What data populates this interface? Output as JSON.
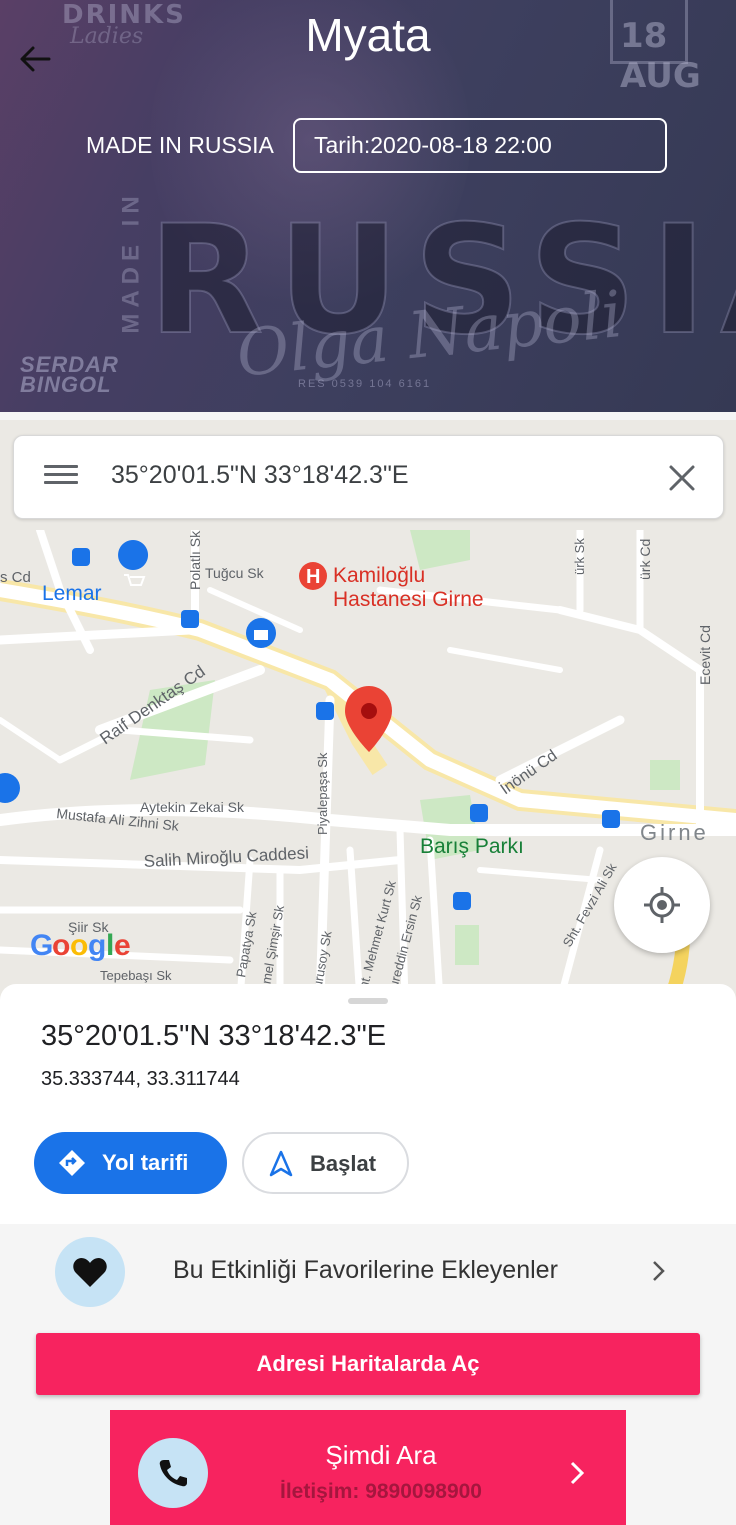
{
  "header": {
    "title": "Myata",
    "event_name": "MADE IN RUSSIA",
    "date_label": "Tarih:2020-08-18 22:00"
  },
  "poster": {
    "drinks": "DRINKS",
    "ladies": "Ladies",
    "date": "18 AUG",
    "made_in": "MADE IN",
    "russia": "RUSSIA",
    "olga": "Olga Napoli",
    "logo_line1": "SERDAR",
    "logo_line2": "BINGOL",
    "res": "RES 0539 104 6161"
  },
  "map": {
    "search_text": "35°20'01.5\"N 33°18'42.3\"E",
    "labels": {
      "lemar": "Lemar",
      "hospital_1": "Kamiloğlu",
      "hospital_2": "Hastanesi Girne",
      "tugcu": "Tuğcu Sk",
      "polatli": "Polatlı Sk",
      "raif": "Raif Denktaş Cd",
      "aytekin": "Aytekin Zekai Sk",
      "mustafa": "Mustafa Ali Zihni Sk",
      "salih": "Salih Miroğlu Caddesi",
      "piyalepasa": "Piyalepaşa Sk",
      "inonu": "İnönü Cd",
      "baris": "Barış Parkı",
      "girne": "Girne",
      "ecevit": "Ecevit Cd",
      "papatya": "Papatya Sk",
      "temel": "Temel Şimşir Sk",
      "durusoy": "Durusoy Sk",
      "mehmet": "Şht. Mehmet Kurt Sk",
      "nureddin": "Nureddin Ersin Sk",
      "fevzi": "Sht. Fevzi Ali Sk",
      "siir": "Şiir Sk",
      "tepebasi": "Tepebaşı Sk",
      "cd_left": "s Cd",
      "turk": "ürk Sk",
      "turk_cd": "ürk Cd"
    },
    "google": [
      "G",
      "o",
      "o",
      "g",
      "l",
      "e"
    ]
  },
  "sheet": {
    "coord_title": "35°20'01.5\"N 33°18'42.3\"E",
    "coord_decimal": "35.333744, 33.311744",
    "directions_label": "Yol tarifi",
    "start_label": "Başlat"
  },
  "favorites": {
    "label": "Bu Etkinliği Favorilerine Ekleyenler"
  },
  "actions": {
    "open_maps_label": "Adresi Haritalarda Aç",
    "call_title": "Şimdi Ara",
    "call_sub": "İletişim: 9890098900"
  },
  "colors": {
    "accent_pink": "#f7235f",
    "google_blue": "#1a73e8",
    "pin_red": "#ea4335",
    "light_blue": "#c6e3f5"
  }
}
